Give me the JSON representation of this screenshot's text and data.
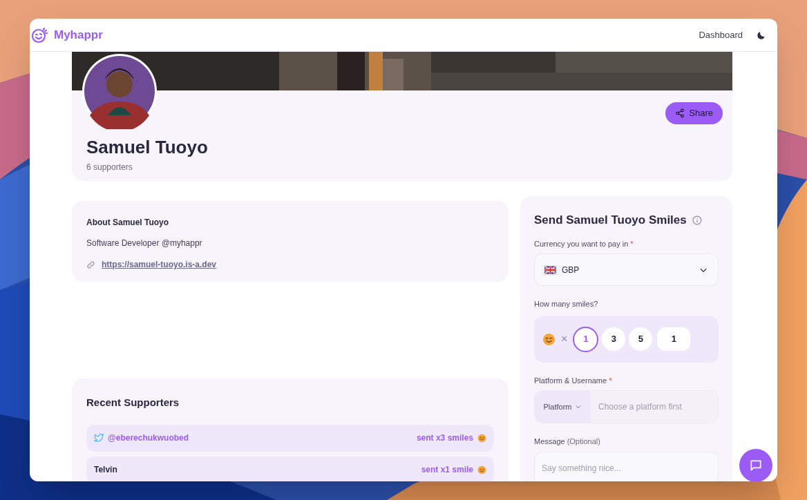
{
  "header": {
    "brand": "Myhappr",
    "nav_link": "Dashboard"
  },
  "profile": {
    "name": "Samuel Tuoyo",
    "supporters": "6 supporters",
    "share_button": "Share"
  },
  "about": {
    "title": "About Samuel Tuoyo",
    "bio": "Software Developer @myhappr",
    "link": "https://samuel-tuoyo.is-a.dev"
  },
  "recent_supporters": {
    "title": "Recent Supporters",
    "items": [
      {
        "kind": "twitter",
        "name": "@eberechukwuobed",
        "sent": "sent x3 smiles"
      },
      {
        "kind": "plain",
        "name": "Telvin",
        "sent": "sent x1 smile"
      }
    ]
  },
  "send_form": {
    "title": "Send Samuel Tuoyo Smiles",
    "currency": {
      "label": "Currency you want to pay in",
      "required_mark": "*",
      "value": "GBP"
    },
    "smiles": {
      "label": "How many smiles?",
      "times": "×",
      "options": [
        {
          "label": "1",
          "selected": true
        },
        {
          "label": "3",
          "selected": false
        },
        {
          "label": "5",
          "selected": false
        }
      ],
      "custom_value": "1"
    },
    "platform": {
      "label": "Platform & Username",
      "required_mark": "*",
      "platform_select": "Platform",
      "placeholder": "Choose a platform first"
    },
    "message": {
      "label": "Message",
      "label_note": "(Optional)",
      "placeholder": "Say something nice..."
    }
  }
}
